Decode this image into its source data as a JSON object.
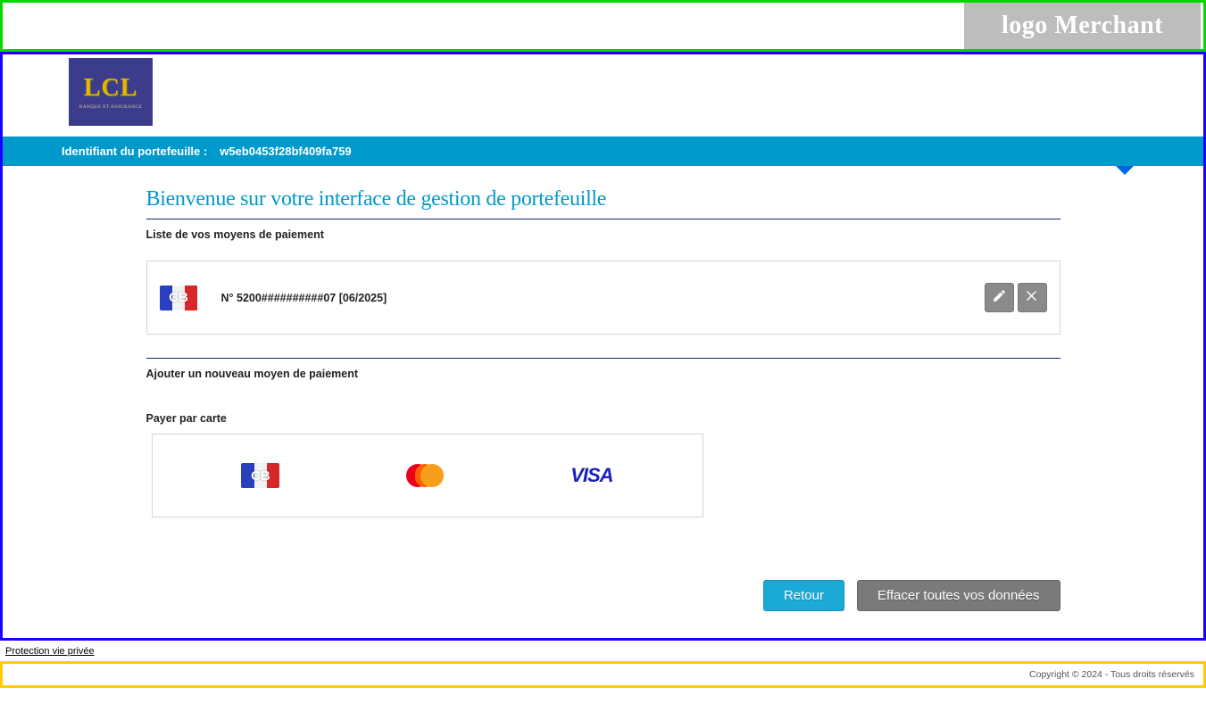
{
  "merchant": {
    "placeholder_label": "logo Merchant"
  },
  "bank_logo": {
    "main": "LCL",
    "sub": "BANQUE ET ASSURANCE"
  },
  "wallet_bar": {
    "label": "Identifiant du portefeuille :",
    "value": "w5eb0453f28bf409fa759"
  },
  "page_title": "Bienvenue sur votre interface de gestion de portefeuille",
  "sections": {
    "list_label": "Liste de vos moyens de paiement",
    "add_label": "Ajouter un nouveau moyen de paiement",
    "pay_by_card_label": "Payer par carte"
  },
  "saved_card": {
    "brand": "CB",
    "display": "N° 5200##########07 [06/2025]"
  },
  "pay_options": {
    "cb": "CB",
    "mastercard": "mastercard",
    "visa": "VISA"
  },
  "buttons": {
    "back": "Retour",
    "clear": "Effacer toutes vos données"
  },
  "privacy_link": "Protection vie privée",
  "footer": "Copyright © 2024 - Tous droits réservés"
}
